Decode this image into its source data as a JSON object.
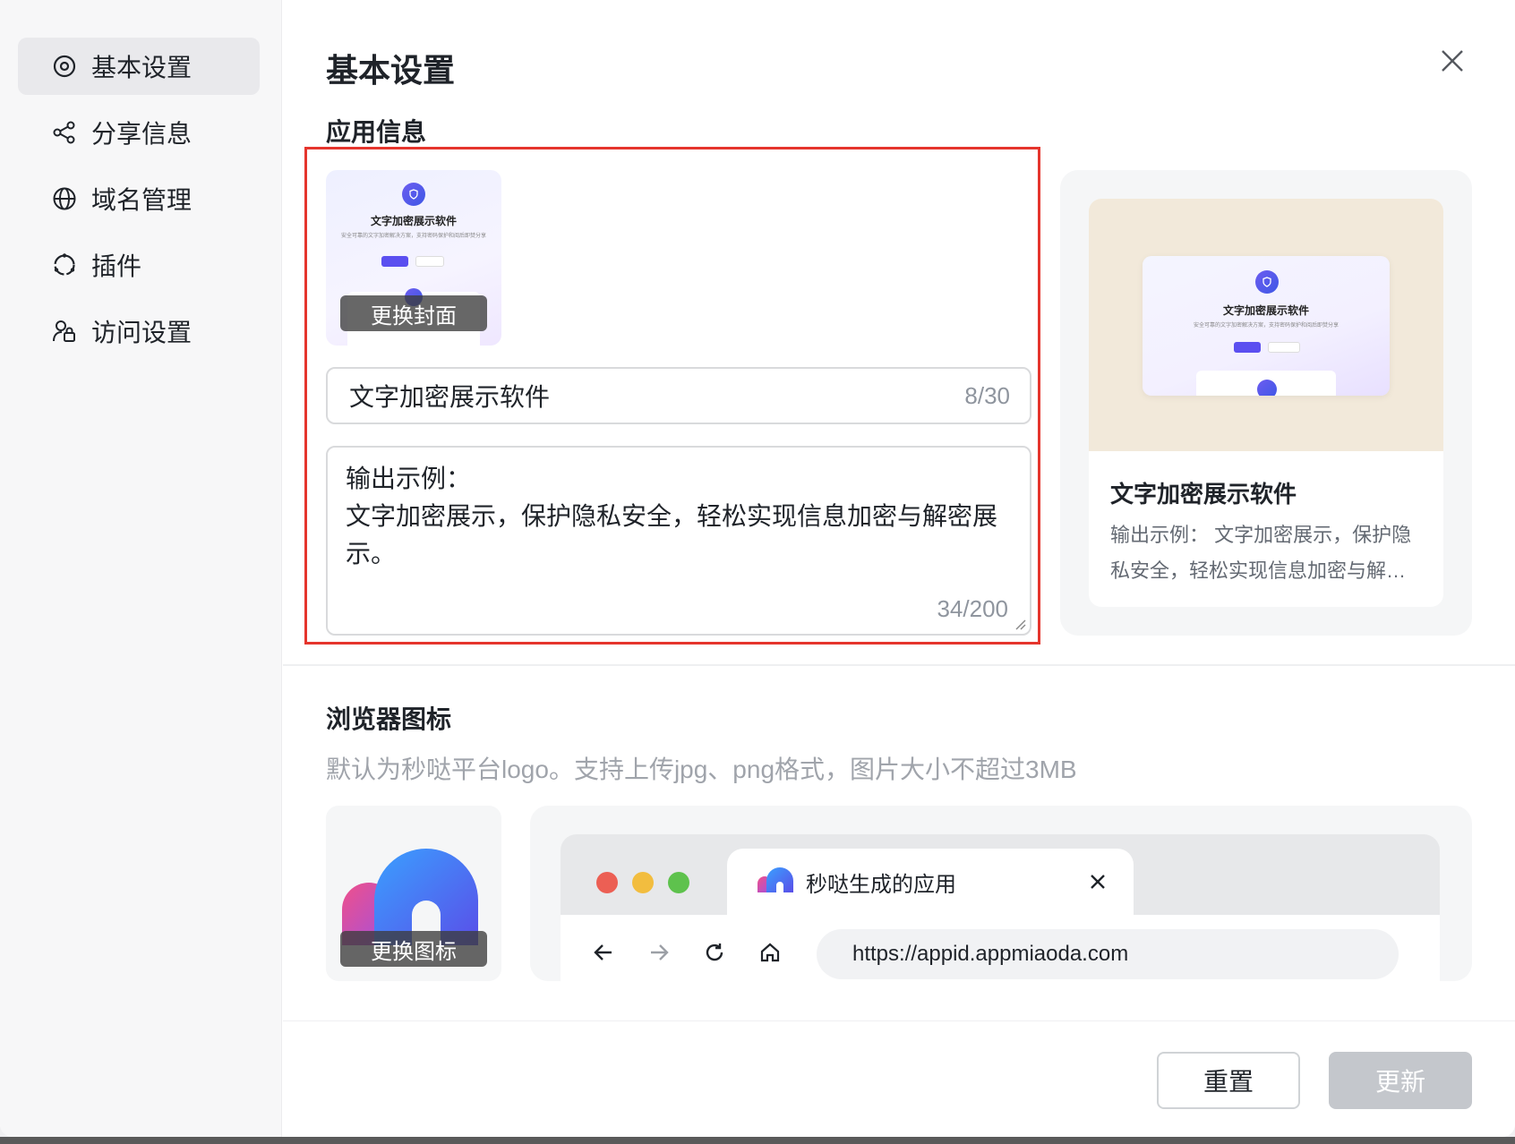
{
  "sidebar": {
    "items": [
      {
        "label": "基本设置",
        "icon": "settings-icon",
        "active": true
      },
      {
        "label": "分享信息",
        "icon": "share-icon"
      },
      {
        "label": "域名管理",
        "icon": "globe-icon"
      },
      {
        "label": "插件",
        "icon": "plugin-icon"
      },
      {
        "label": "访问设置",
        "icon": "user-lock-icon"
      }
    ]
  },
  "header": {
    "title": "基本设置"
  },
  "app_info": {
    "section_title": "应用信息",
    "cover": {
      "mini_title": "文字加密展示软件",
      "mini_subtitle": "安全可靠的文字加密解决方案，支持密码保护和阅后即焚分享",
      "change_label": "更换封面"
    },
    "name": {
      "value": "文字加密展示软件",
      "count": "8/30"
    },
    "description": {
      "value": "输出示例：\n文字加密展示，保护隐私安全，轻松实现信息加密与解密展示。",
      "count": "34/200"
    },
    "preview": {
      "name": "文字加密展示软件",
      "desc": "输出示例：  文字加密展示，保护隐私安全，轻松实现信息加密与解…"
    }
  },
  "browser_icon": {
    "section_title": "浏览器图标",
    "hint": "默认为秒哒平台logo。支持上传jpg、png格式，图片大小不超过3MB",
    "change_label": "更换图标",
    "tab_title": "秒哒生成的应用",
    "url": "https://appid.appmiaoda.com",
    "colors": {
      "red": "#ec5f54",
      "yellow": "#f2bd3f",
      "green": "#5ec24d"
    }
  },
  "footer": {
    "reset_label": "重置",
    "update_label": "更新"
  }
}
